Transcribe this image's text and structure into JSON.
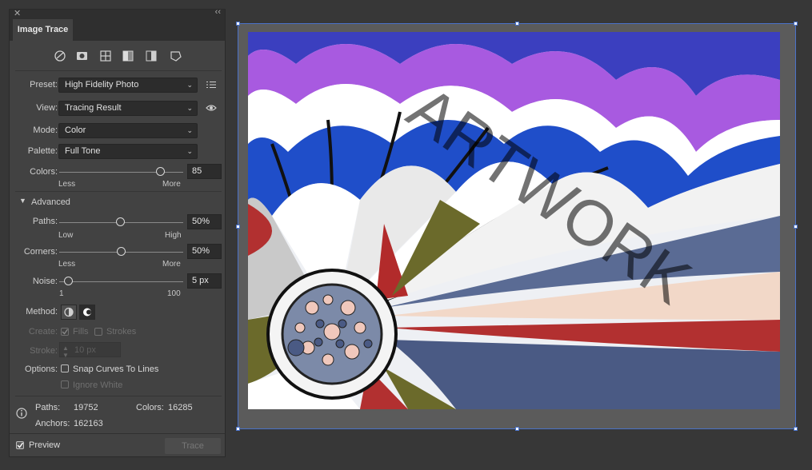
{
  "panel": {
    "close_glyph": "✕",
    "collapse_glyph": "‹‹",
    "tab": "Image Trace",
    "presets_icons": [
      "auto-color-icon",
      "high-color-icon",
      "low-color-icon",
      "grayscale-icon",
      "black-white-icon",
      "outline-icon"
    ],
    "preset": {
      "label": "Preset:",
      "value": "High Fidelity Photo"
    },
    "view": {
      "label": "View:",
      "value": "Tracing Result"
    },
    "mode": {
      "label": "Mode:",
      "value": "Color"
    },
    "palette": {
      "label": "Palette:",
      "value": "Full Tone"
    },
    "colors": {
      "label": "Colors:",
      "value": "85",
      "min_label": "Less",
      "max_label": "More",
      "level": 0.83
    },
    "advanced": "Advanced",
    "paths": {
      "label": "Paths:",
      "value": "50%",
      "min_label": "Low",
      "max_label": "High",
      "level": 0.5
    },
    "corners": {
      "label": "Corners:",
      "value": "50%",
      "min_label": "Less",
      "max_label": "More",
      "level": 0.5
    },
    "noise": {
      "label": "Noise:",
      "value": "5 px",
      "min_label": "1",
      "max_label": "100",
      "level": 0.04
    },
    "method": {
      "label": "Method:"
    },
    "create": {
      "label": "Create:",
      "fills": "Fills",
      "strokes": "Strokes"
    },
    "stroke": {
      "label": "Stroke:",
      "value": "10 px"
    },
    "options": {
      "label": "Options:",
      "snap": "Snap Curves To Lines",
      "ignore_white": "Ignore White"
    },
    "stats": {
      "paths_label": "Paths:",
      "paths_value": "19752",
      "colors_label": "Colors:",
      "colors_value": "16285",
      "anchors_label": "Anchors:",
      "anchors_value": "162163"
    },
    "preview": "Preview",
    "trace": "Trace"
  },
  "artwork": {
    "watermark": "ARTWORK"
  },
  "colors": {
    "panel_bg": "#424242",
    "canvas_bg": "#373737",
    "selection": "#4a72c8"
  }
}
